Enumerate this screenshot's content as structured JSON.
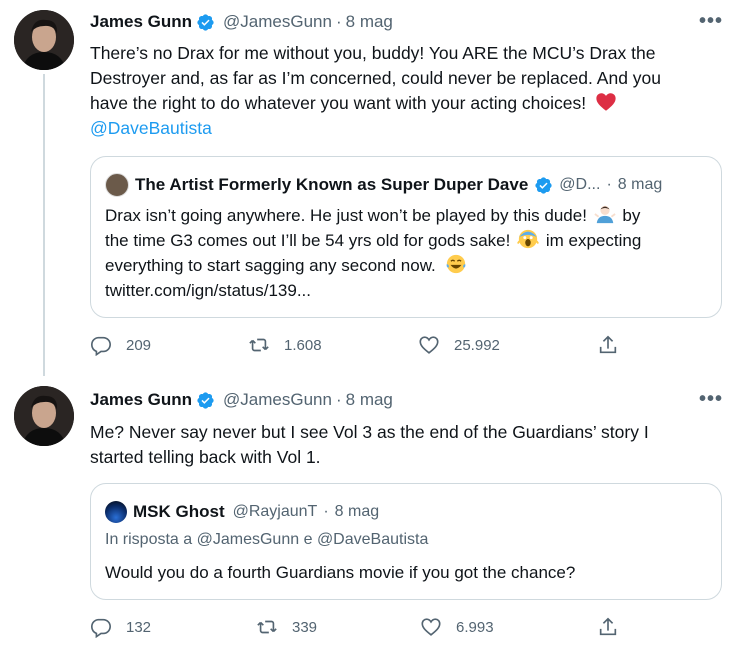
{
  "tweet1": {
    "author": "James Gunn",
    "handle": "@JamesGunn",
    "separator": "·",
    "date": "8 mag",
    "text_lines": [
      "There’s no Drax for me without you, buddy! You ARE the MCU’s Drax the",
      "Destroyer and, as far as I’m concerned, could never be replaced. And you",
      "have the right to do whatever you want with your acting choices!"
    ],
    "mention": "@DaveBautista",
    "quoted": {
      "author": "The Artist Formerly Known as Super Duper Dave",
      "handle": "@D...",
      "separator": "·",
      "date": "8 mag",
      "line1": "Drax isn’t going anywhere. He just won’t be played by this dude!",
      "line1b": "by",
      "line2": "the time G3 comes out I’ll be 54 yrs old for gods sake!",
      "line2b": "im expecting",
      "line3": "everything to start sagging any second now.",
      "line4": "twitter.com/ign/status/139..."
    },
    "replies": "209",
    "retweets": "1.608",
    "likes": "25.992"
  },
  "tweet2": {
    "author": "James Gunn",
    "handle": "@JamesGunn",
    "separator": "·",
    "date": "8 mag",
    "text_lines": [
      "Me? Never say never but I see Vol 3 as the end of the Guardians’ story I",
      "started telling back with Vol 1."
    ],
    "quoted": {
      "author": "MSK Ghost",
      "handle": "@RayjaunT",
      "separator": "·",
      "date": "8 mag",
      "reply_prefix": "In risposta a",
      "reply_mention1": "@JamesGunn",
      "reply_and": "e",
      "reply_mention2": "@DaveBautista",
      "text": "Would you do a fourth Guardians movie if you got the chance?"
    },
    "replies": "132",
    "retweets": "339",
    "likes": "6.993"
  },
  "icons": {
    "verified": "verified-badge-icon",
    "more": "more-icon",
    "reply": "reply-icon",
    "retweet": "retweet-icon",
    "like": "like-icon",
    "share": "share-icon"
  },
  "colors": {
    "accent": "#1d9bf0",
    "secondary_text": "#536471",
    "heart": "#e0245e"
  }
}
